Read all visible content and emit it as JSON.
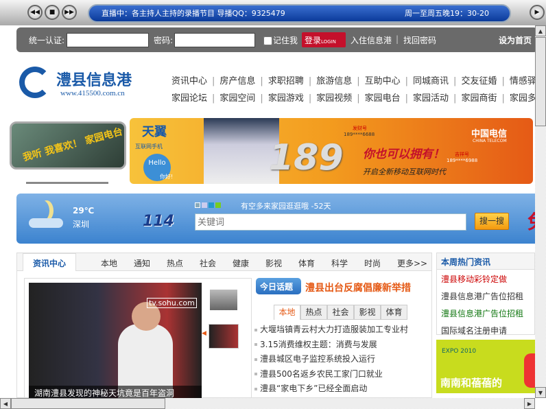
{
  "player": {
    "broadcast": "直播中：各主持人主持的录播节目 导播QQ：9325479",
    "schedule": "周一至周五晚19：30-20"
  },
  "login": {
    "account_label": "统一认证:",
    "password_label": "密码:",
    "remember_label": "记住我",
    "login_button": "登录",
    "login_button_en": "LOGIN",
    "join_link": "入住信息港",
    "separator": "|",
    "recover_link": "找回密码",
    "set_home": "设为首页"
  },
  "logo": {
    "title": "澧县信息港",
    "url": "www.415500.com.cn"
  },
  "nav": {
    "row1": [
      "资讯中心",
      "房产信息",
      "求职招聘",
      "旅游信息",
      "互助中心",
      "同城商讯",
      "交友征婚",
      "情感驿"
    ],
    "row2": [
      "家园论坛",
      "家园空间",
      "家园游戏",
      "家园视频",
      "家园电台",
      "家园活动",
      "家园商街",
      "家园多"
    ]
  },
  "left_ad": {
    "text": "我听 我喜欢！ 家园电台"
  },
  "banner": {
    "brand": "天翼",
    "brand_sub": "互联网手机",
    "hello": "Hello",
    "nihao": "你好!",
    "number": "189",
    "slogan": "你也可以拥有！",
    "tagline": "开启全新移动互联网时代",
    "lucky1_label": "发财号",
    "lucky1": "189****6688",
    "lucky2_label": "吉祥号",
    "lucky2": "189****6988",
    "telecom": "中国电信",
    "telecom_en": "CHINA TELECOM"
  },
  "weather": {
    "temp": "29℃",
    "city": "深圳"
  },
  "search": {
    "logo": "114",
    "notice": "有空多来家园逛逛哦 -52天",
    "placeholder": "关键词",
    "button": "搜一搜",
    "side_char": "免"
  },
  "news": {
    "tabs": [
      "资讯中心",
      "本地",
      "通知",
      "热点",
      "社会",
      "健康",
      "影视",
      "体育",
      "科学",
      "时尚",
      "更多>>"
    ],
    "video_caption": "湖南澧县发现的神秘天坑竟是百年盗洞",
    "video_watermark": "tv.sohu.com",
    "topic_badge": "今日话题",
    "topic_title": "澧县出台反腐倡廉新举措",
    "subtabs": [
      "本地",
      "热点",
      "社会",
      "影视",
      "体育"
    ],
    "items": [
      "大堰垱镇青云村大力打造服装加工专业村",
      "3.15消费维权主题：消费与发展",
      "澧县城区电子监控系统投入运行",
      "澧县500名返乡农民工家门口就业",
      "澧县“家电下乡”已经全面启动"
    ]
  },
  "hot": {
    "title": "本周热门资讯",
    "items": [
      {
        "text": "澧县移动彩铃定做",
        "color": "#cc0000"
      },
      {
        "text": "澧县信息港广告位招租",
        "color": "#333333"
      },
      {
        "text": "澧县信息港广告位招租",
        "color": "#117711"
      },
      {
        "text": "国际域名注册申请",
        "color": "#333333"
      }
    ]
  },
  "expo_ad": {
    "text": "南南和蓓蓓的",
    "expo": "EXPO 2010"
  }
}
